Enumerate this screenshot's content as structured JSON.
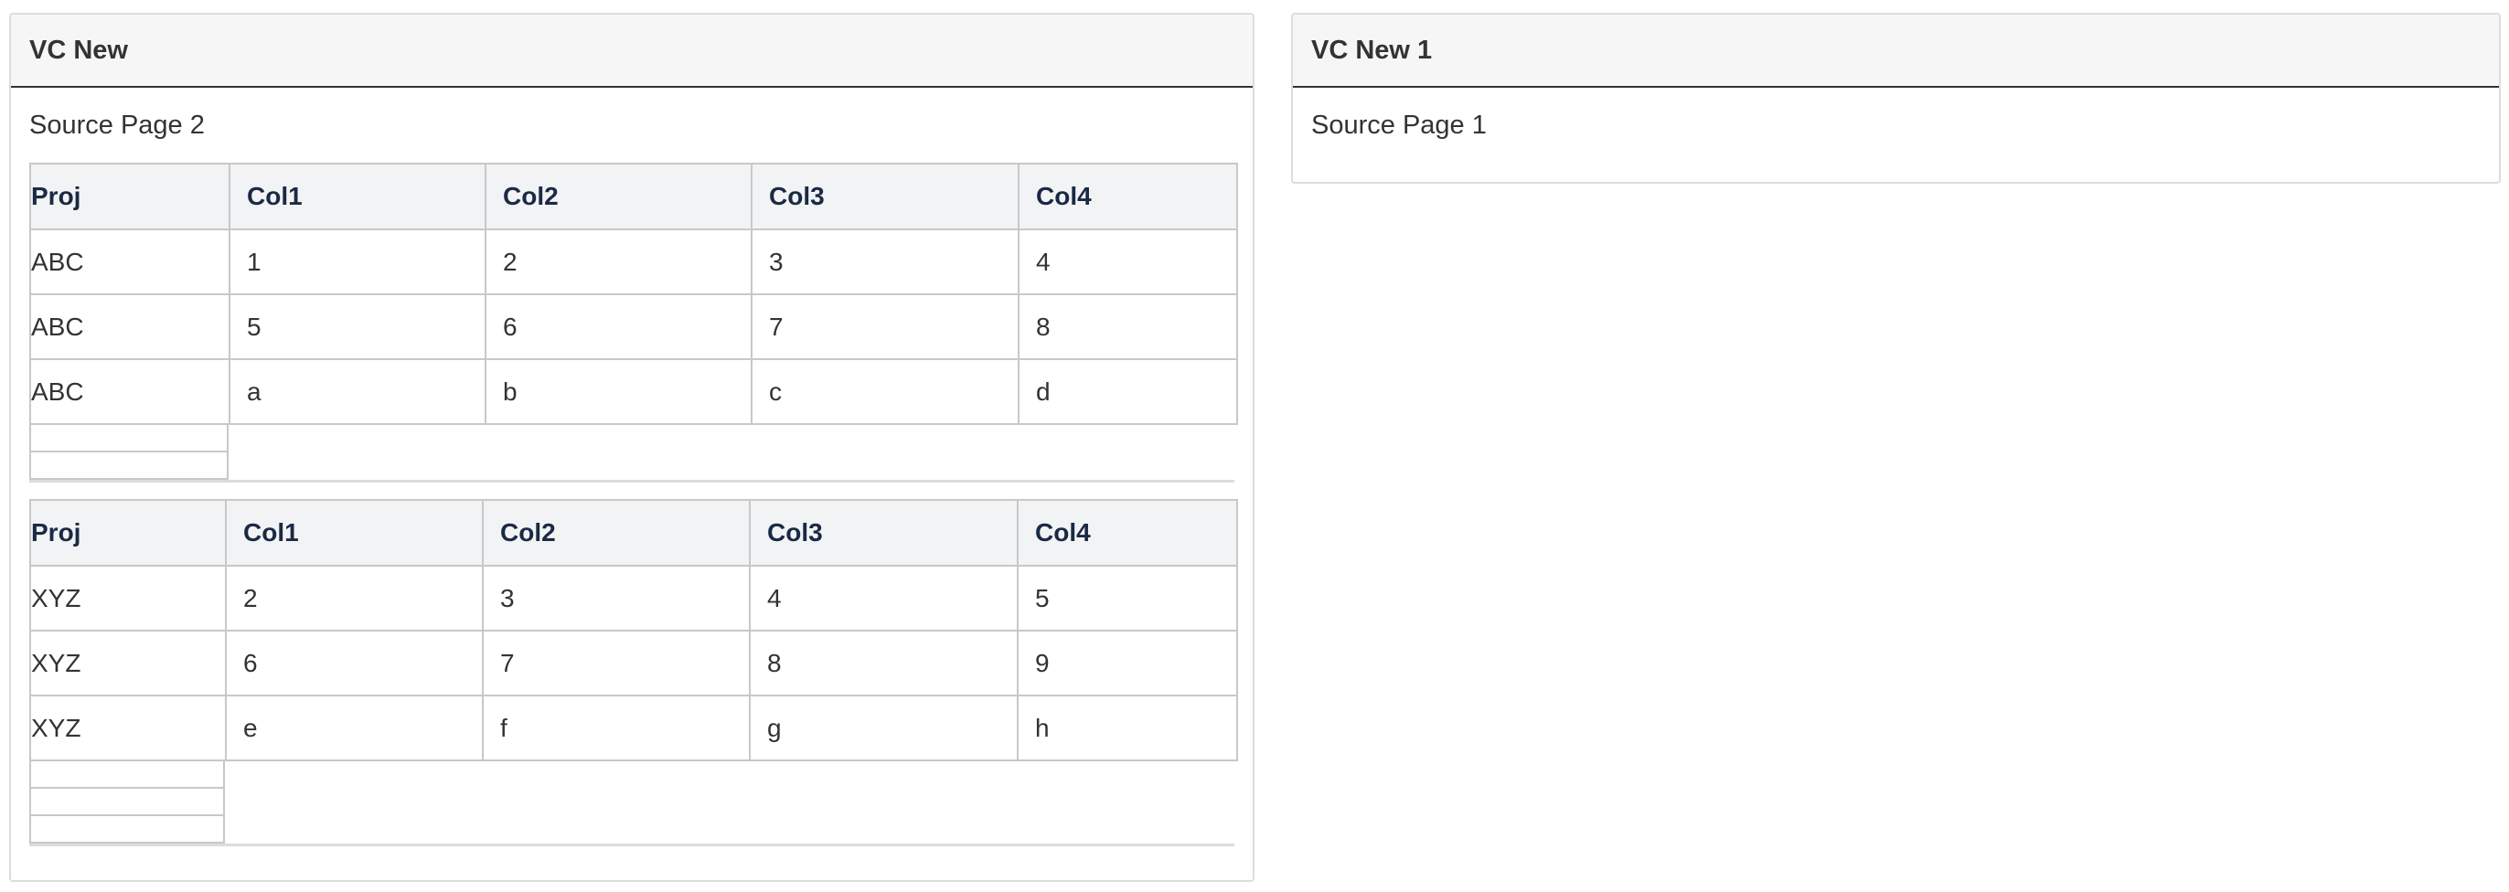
{
  "left_panel": {
    "title": "VC New",
    "source_text": "Source Page 2",
    "tables": [
      {
        "headers": [
          "Proj",
          "Col1",
          "Col2",
          "Col3",
          "Col4"
        ],
        "rows": [
          [
            "ABC",
            "1",
            "2",
            "3",
            "4"
          ],
          [
            "ABC",
            "5",
            "6",
            "7",
            "8"
          ],
          [
            "ABC",
            "a",
            "b",
            "c",
            "d"
          ]
        ]
      },
      {
        "headers": [
          "Proj",
          "Col1",
          "Col2",
          "Col3",
          "Col4"
        ],
        "rows": [
          [
            "XYZ",
            "2",
            "3",
            "4",
            "5"
          ],
          [
            "XYZ",
            "6",
            "7",
            "8",
            "9"
          ],
          [
            "XYZ",
            "e",
            "f",
            "g",
            "h"
          ]
        ]
      }
    ]
  },
  "right_panel": {
    "title": "VC New 1",
    "source_text": "Source Page 1"
  }
}
